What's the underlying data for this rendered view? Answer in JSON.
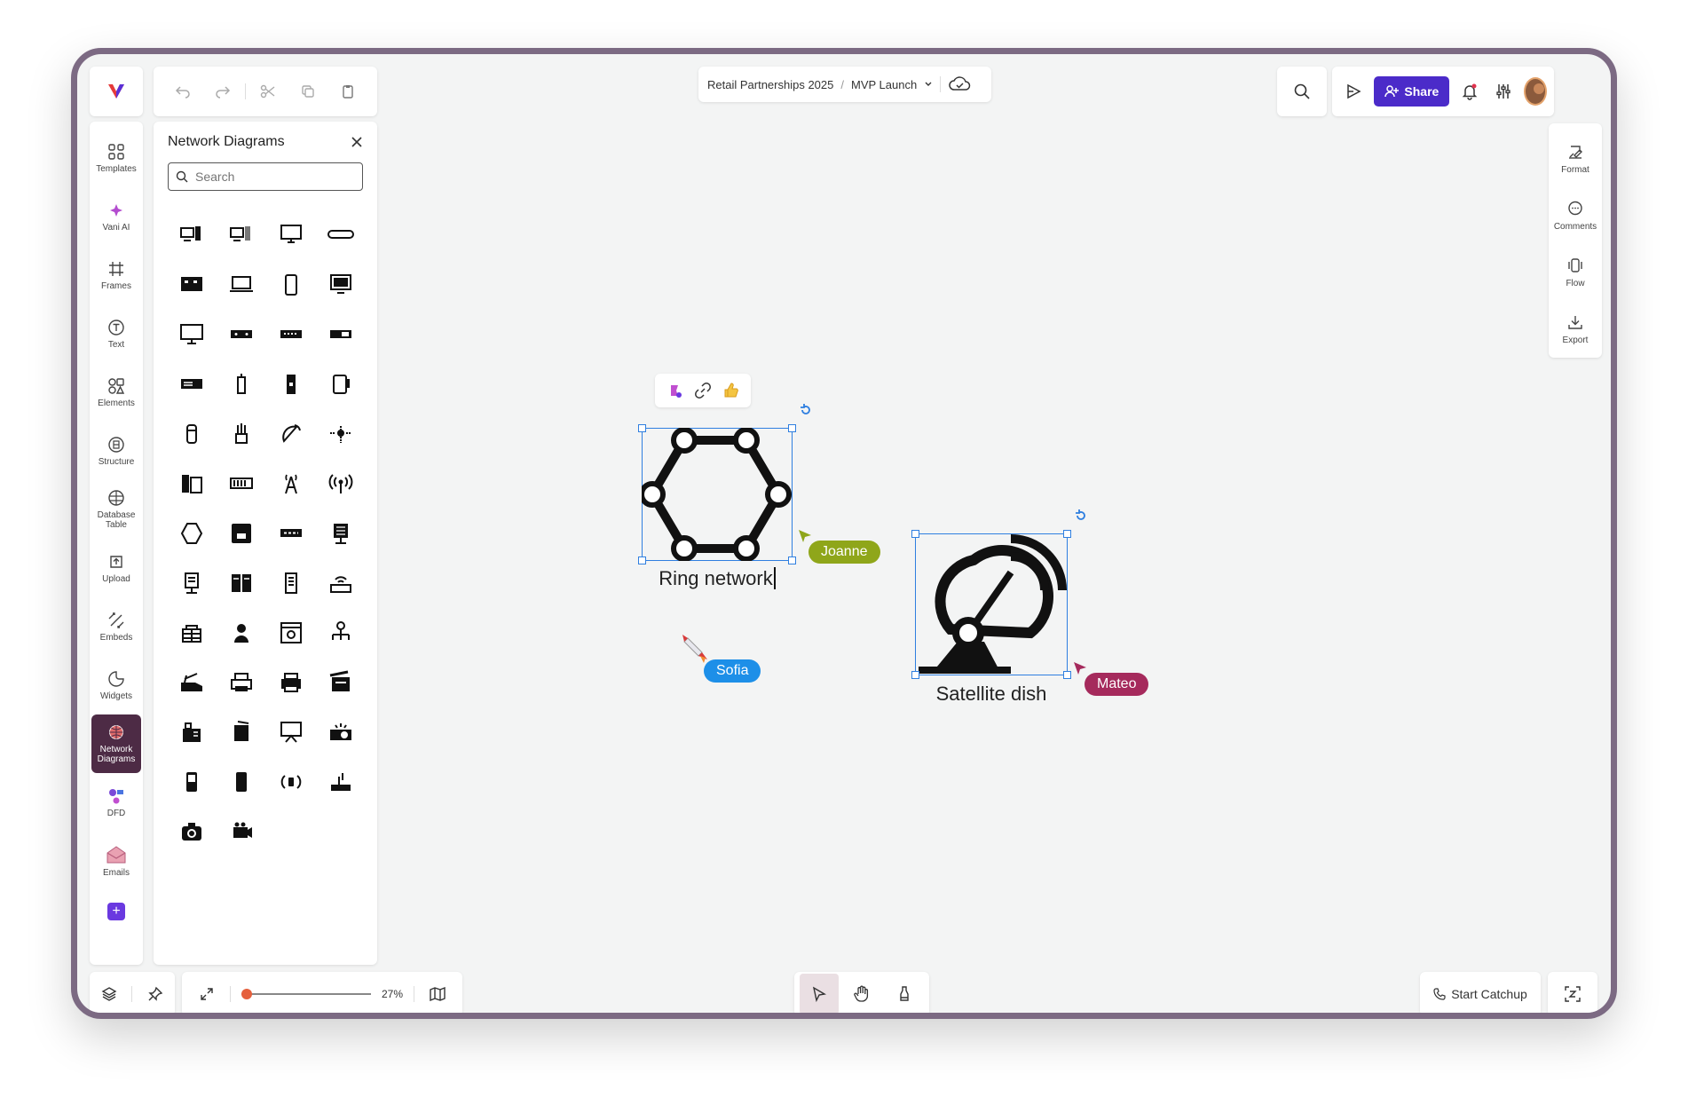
{
  "header": {
    "breadcrumb_project": "Retail Partnerships 2025",
    "breadcrumb_separator": "/",
    "breadcrumb_board": "MVP Launch",
    "share_label": "Share"
  },
  "left_rail": {
    "items": [
      {
        "label": "Templates",
        "icon": "templates-icon"
      },
      {
        "label": "Vani AI",
        "icon": "sparkle-icon"
      },
      {
        "label": "Frames",
        "icon": "frame-icon"
      },
      {
        "label": "Text",
        "icon": "text-icon"
      },
      {
        "label": "Elements",
        "icon": "elements-icon"
      },
      {
        "label": "Structure",
        "icon": "structure-icon"
      },
      {
        "label": "Database Table",
        "icon": "database-icon"
      },
      {
        "label": "Upload",
        "icon": "upload-icon"
      },
      {
        "label": "Embeds",
        "icon": "embed-icon"
      },
      {
        "label": "Widgets",
        "icon": "widget-icon"
      },
      {
        "label": "Network Diagrams",
        "icon": "network-icon",
        "active": true
      },
      {
        "label": "DFD",
        "icon": "dfd-icon"
      },
      {
        "label": "Emails",
        "icon": "email-icon"
      }
    ]
  },
  "shapes_panel": {
    "title": "Network Diagrams",
    "search_placeholder": "Search",
    "shape_count": 50
  },
  "canvas": {
    "ring_label": "Ring network",
    "dish_label": "Satellite dish",
    "collaborators": [
      {
        "name": "Joanne",
        "color": "#8fa61a"
      },
      {
        "name": "Sofia",
        "color": "#1d8fe8"
      },
      {
        "name": "Mateo",
        "color": "#a52a5c"
      }
    ]
  },
  "right_rail": {
    "items": [
      {
        "label": "Format",
        "icon": "format-icon"
      },
      {
        "label": "Comments",
        "icon": "comment-icon"
      },
      {
        "label": "Flow",
        "icon": "flow-icon"
      },
      {
        "label": "Export",
        "icon": "export-icon"
      }
    ]
  },
  "bottom": {
    "zoom_level": "27%",
    "catchup_label": "Start Catchup"
  },
  "colors": {
    "accent": "#4b2bc9",
    "selection": "#2f7fe0",
    "frame": "#7c6a83"
  }
}
